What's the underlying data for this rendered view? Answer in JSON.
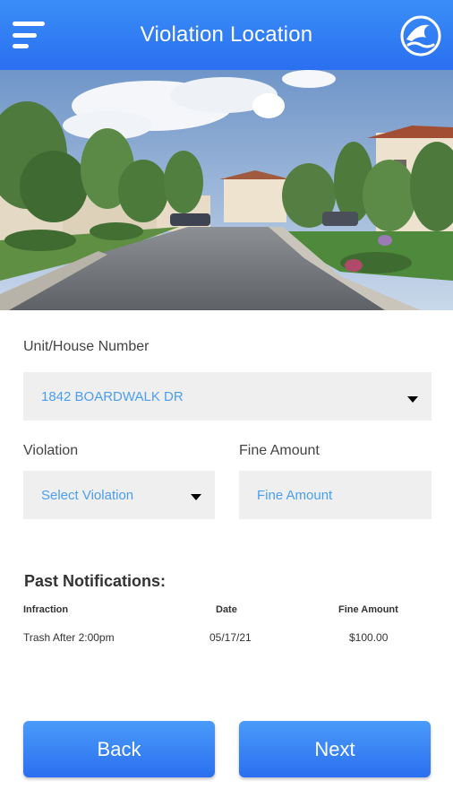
{
  "header": {
    "title": "Violation Location",
    "menu_icon": "hamburger-menu-icon",
    "logo_icon": "wave-logo-icon",
    "color": "#2a6ff0"
  },
  "form": {
    "unit_label": "Unit/House Number",
    "unit_value": "1842 BOARDWALK DR",
    "violation_label": "Violation",
    "violation_placeholder": "Select Violation",
    "fine_label": "Fine Amount",
    "fine_placeholder": "Fine Amount",
    "value_color": "#4a9eef"
  },
  "past_notifications": {
    "title": "Past Notifications:",
    "columns": [
      "Infraction",
      "Date",
      "Fine Amount"
    ],
    "rows": [
      {
        "infraction": "Trash After 2:00pm",
        "date": "05/17/21",
        "fine": "$100.00"
      }
    ]
  },
  "buttons": {
    "back": "Back",
    "next": "Next"
  }
}
